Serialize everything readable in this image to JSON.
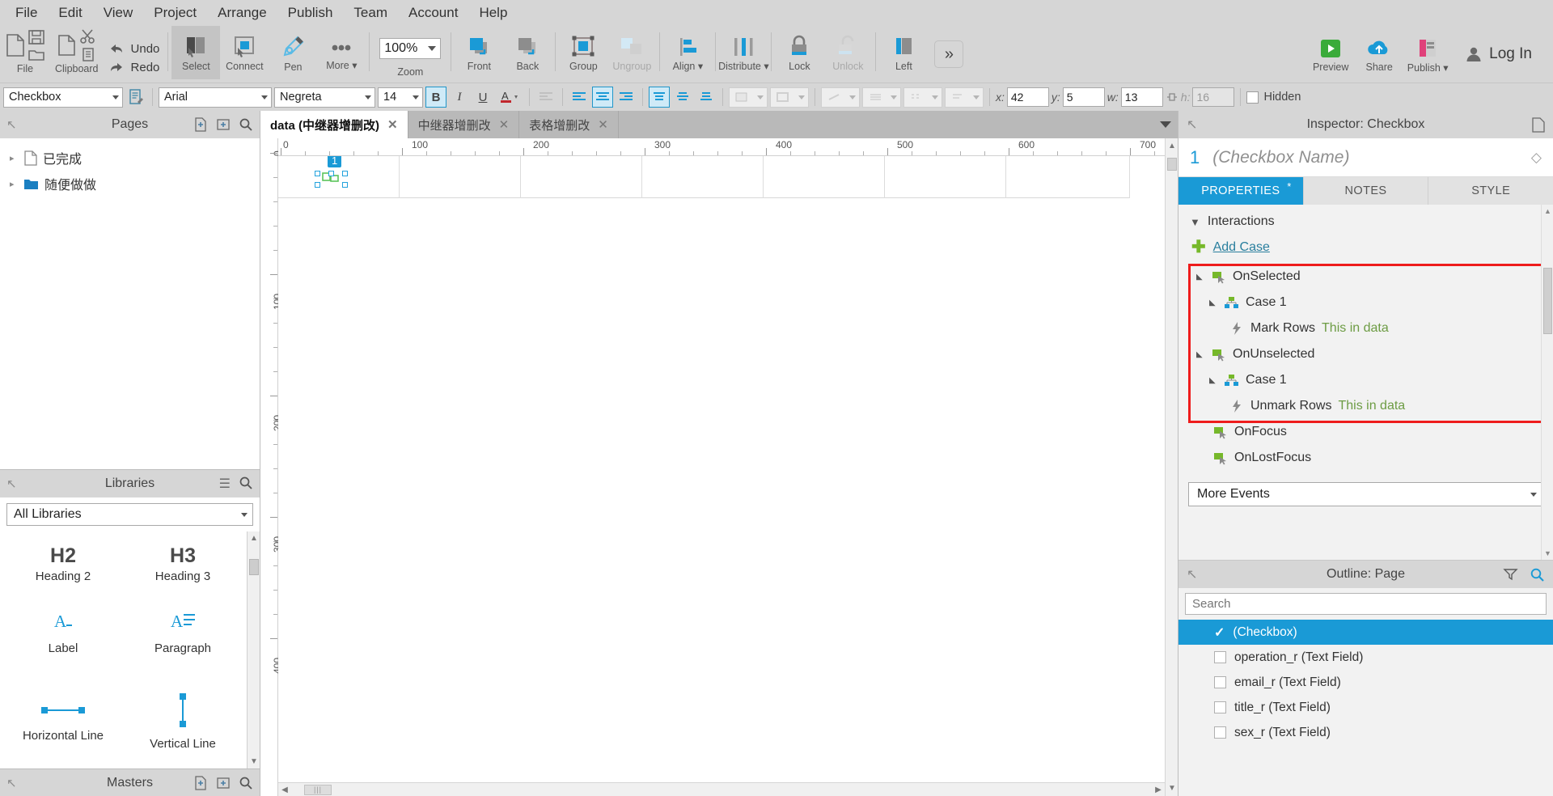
{
  "menu": {
    "items": [
      "File",
      "Edit",
      "View",
      "Project",
      "Arrange",
      "Publish",
      "Team",
      "Account",
      "Help"
    ]
  },
  "ribbon": {
    "groups": [
      {
        "name": "file",
        "label": "File"
      },
      {
        "name": "clipboard",
        "label": "Clipboard"
      },
      {
        "name": "history",
        "undo": "Undo",
        "redo": "Redo"
      }
    ],
    "buttons": [
      {
        "name": "select",
        "label": "Select",
        "icon": "select-icon",
        "state": "selected"
      },
      {
        "name": "connect",
        "label": "Connect",
        "icon": "connect-icon",
        "state": "normal"
      },
      {
        "name": "pen",
        "label": "Pen",
        "icon": "pen-icon",
        "state": "normal"
      },
      {
        "name": "more",
        "label": "More",
        "icon": "more-dots-icon",
        "state": "normal",
        "dropdown": true
      }
    ],
    "zoom": {
      "value": "100%",
      "label": "Zoom"
    },
    "arrange": [
      {
        "name": "front",
        "label": "Front",
        "icon": "bring-front-icon",
        "state": "normal"
      },
      {
        "name": "back",
        "label": "Back",
        "icon": "send-back-icon",
        "state": "normal"
      },
      {
        "name": "group",
        "label": "Group",
        "icon": "group-icon",
        "state": "normal"
      },
      {
        "name": "ungroup",
        "label": "Ungroup",
        "icon": "ungroup-icon",
        "state": "disabled"
      },
      {
        "name": "align",
        "label": "Align",
        "icon": "align-icon",
        "state": "normal",
        "dropdown": true
      },
      {
        "name": "distribute",
        "label": "Distribute",
        "icon": "distribute-icon",
        "state": "normal",
        "dropdown": true
      },
      {
        "name": "lock",
        "label": "Lock",
        "icon": "lock-icon",
        "state": "normal"
      },
      {
        "name": "unlock",
        "label": "Unlock",
        "icon": "unlock-icon",
        "state": "disabled"
      },
      {
        "name": "left",
        "label": "Left",
        "icon": "left-panel-icon",
        "state": "normal"
      }
    ],
    "overflow_label": "»",
    "right": [
      {
        "name": "preview",
        "label": "Preview",
        "icon": "play-icon"
      },
      {
        "name": "share",
        "label": "Share",
        "icon": "cloud-icon"
      },
      {
        "name": "publish",
        "label": "Publish",
        "icon": "publish-icon",
        "dropdown": true
      }
    ],
    "login_label": "Log In"
  },
  "format": {
    "widget_type": "Checkbox",
    "font_family": "Arial",
    "font_style": "Negreta",
    "font_size": "14",
    "bold": "B",
    "italic": "I",
    "underline": "U",
    "color_label": "A",
    "coords": {
      "x_label": "x:",
      "x_value": "42",
      "y_label": "y:",
      "y_value": "5",
      "w_label": "w:",
      "w_value": "13",
      "h_label": "h:",
      "h_value": "16",
      "hidden_label": "Hidden"
    }
  },
  "pages": {
    "title": "Pages",
    "items": [
      {
        "label": "已完成",
        "icon": "page-icon",
        "type": "page"
      },
      {
        "label": "随便做做",
        "icon": "folder-icon",
        "type": "folder"
      }
    ]
  },
  "libraries": {
    "title": "Libraries",
    "selected": "All Libraries",
    "items": [
      {
        "label": "Heading 2",
        "icon": "heading2-icon"
      },
      {
        "label": "Heading 3",
        "icon": "heading3-icon"
      },
      {
        "label": "Label",
        "icon": "label-icon"
      },
      {
        "label": "Paragraph",
        "icon": "paragraph-icon"
      },
      {
        "label": "Horizontal Line",
        "icon": "hline-icon"
      },
      {
        "label": "Vertical Line",
        "icon": "vline-icon"
      }
    ]
  },
  "masters": {
    "title": "Masters"
  },
  "canvas": {
    "tabs": [
      {
        "label": "data (中继器增删改)",
        "active": true,
        "closable": true
      },
      {
        "label": "中继器增删改",
        "active": false,
        "closable": true
      },
      {
        "label": "表格增删改",
        "active": false,
        "closable": true
      }
    ],
    "h_ruler_labels": [
      "0",
      "100",
      "200",
      "300",
      "400",
      "500",
      "600",
      "700"
    ],
    "v_ruler_labels": [
      "0",
      "100",
      "200",
      "300",
      "400"
    ],
    "selected_widget": {
      "badge": "1"
    }
  },
  "inspector": {
    "title": "Inspector: Checkbox",
    "widget_number": "1",
    "widget_name": "(Checkbox Name)",
    "tabs": [
      {
        "label": "PROPERTIES",
        "active": true,
        "asterisk": "*"
      },
      {
        "label": "NOTES",
        "active": false,
        "asterisk": ""
      },
      {
        "label": "STYLE",
        "active": false,
        "asterisk": ""
      }
    ],
    "section_title": "Interactions",
    "add_case_label": "Add Case",
    "events": [
      {
        "label": "OnSelected",
        "level": 0,
        "icon": "event-icon",
        "expanded": true,
        "highlighted": true
      },
      {
        "label": "Case 1",
        "level": 1,
        "icon": "case-icon",
        "expanded": true,
        "highlighted": true
      },
      {
        "label": "Mark Rows",
        "detail": "This in data",
        "level": 2,
        "icon": "action-icon",
        "highlighted": true
      },
      {
        "label": "OnUnselected",
        "level": 0,
        "icon": "event-icon",
        "expanded": true,
        "highlighted": true
      },
      {
        "label": "Case 1",
        "level": 1,
        "icon": "case-icon",
        "expanded": true,
        "highlighted": true
      },
      {
        "label": "Unmark Rows",
        "detail": "This in data",
        "level": 2,
        "icon": "action-icon",
        "highlighted": true
      },
      {
        "label": "OnFocus",
        "level": 0,
        "icon": "event-icon",
        "expanded": false,
        "highlighted": false
      },
      {
        "label": "OnLostFocus",
        "level": 0,
        "icon": "event-icon",
        "expanded": false,
        "highlighted": false
      }
    ],
    "more_events_label": "More Events",
    "highlight_color": "#ee1c1c"
  },
  "outline": {
    "title": "Outline: Page",
    "search_placeholder": "Search",
    "items": [
      {
        "label": "(Checkbox)",
        "selected": true,
        "icon": "check-icon"
      },
      {
        "label": "operation_r (Text Field)",
        "selected": false,
        "icon": "textfield-icon"
      },
      {
        "label": "email_r (Text Field)",
        "selected": false,
        "icon": "textfield-icon"
      },
      {
        "label": "title_r (Text Field)",
        "selected": false,
        "icon": "textfield-icon"
      },
      {
        "label": "sex_r (Text Field)",
        "selected": false,
        "icon": "textfield-icon"
      }
    ]
  },
  "colors": {
    "accent": "#1a9ad6",
    "green": "#76b82a",
    "red": "#ee1c1c",
    "chrome": "#d6d6d6"
  }
}
